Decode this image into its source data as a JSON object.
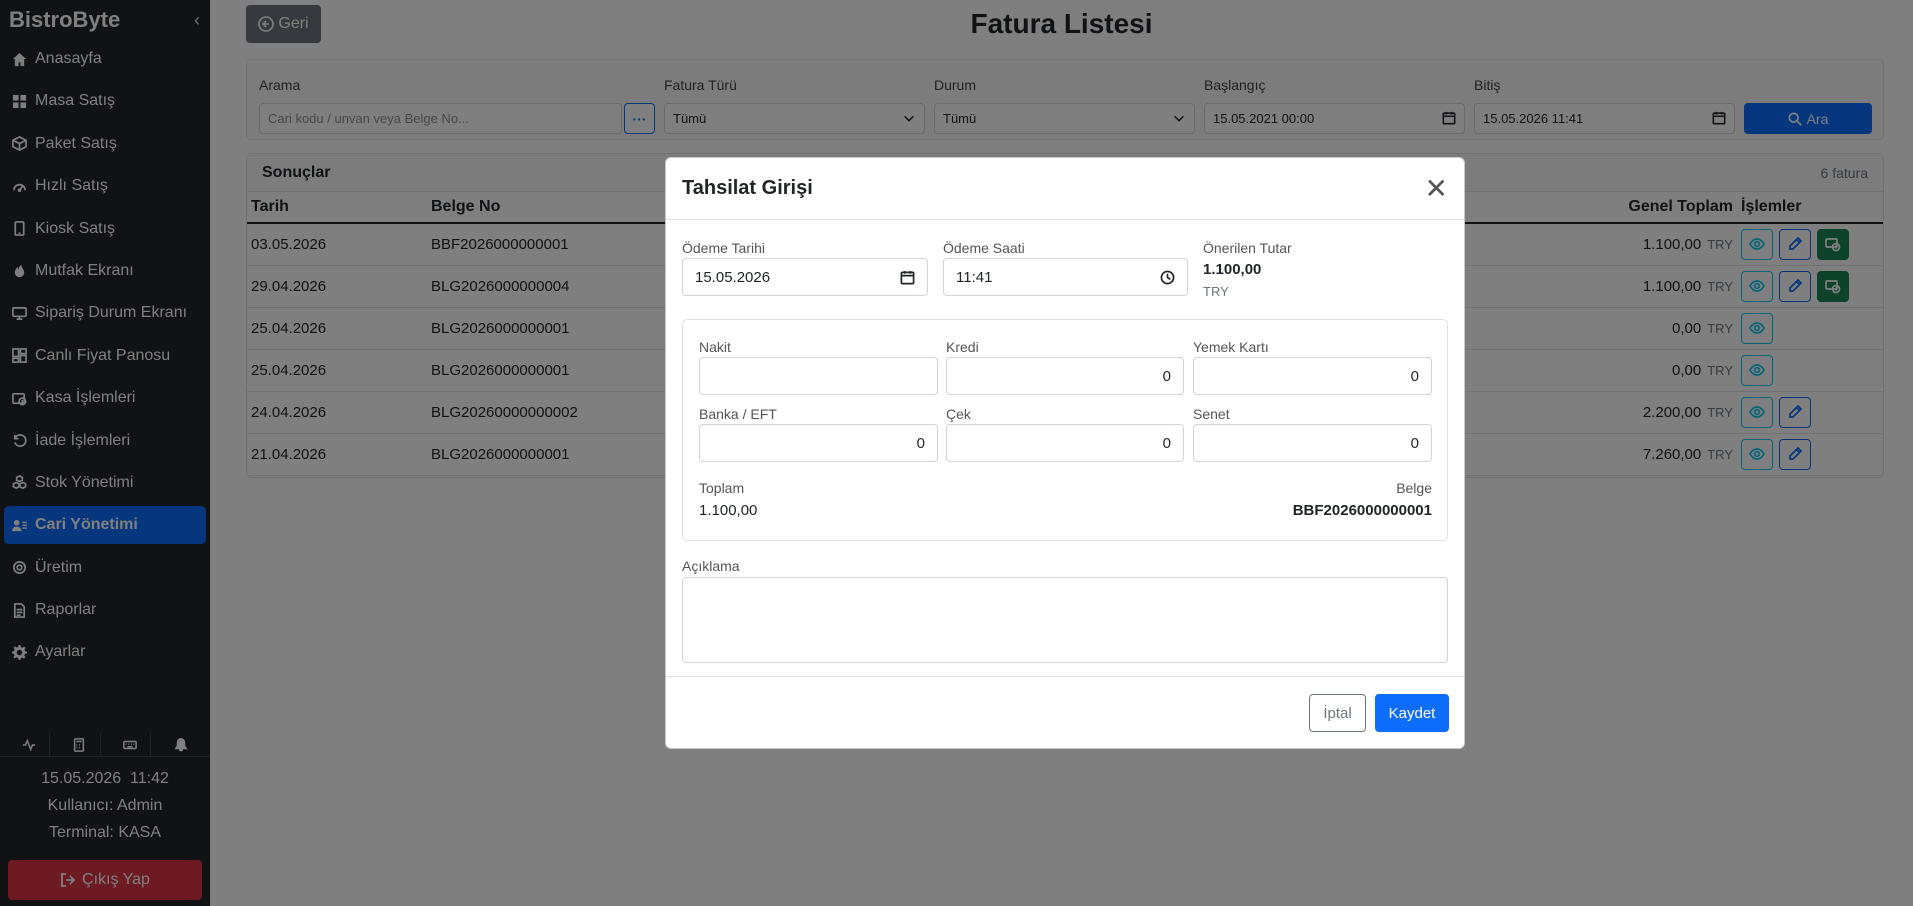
{
  "app": {
    "brand": "BistroByte"
  },
  "sidebar": {
    "items": [
      {
        "label": "Anasayfa",
        "icon": "home-icon"
      },
      {
        "label": "Masa Satış",
        "icon": "grid-icon"
      },
      {
        "label": "Paket Satış",
        "icon": "box-icon"
      },
      {
        "label": "Hızlı Satış",
        "icon": "speedometer-icon"
      },
      {
        "label": "Kiosk Satış",
        "icon": "tablet-icon"
      },
      {
        "label": "Mutfak Ekranı",
        "icon": "fire-icon"
      },
      {
        "label": "Sipariş Durum Ekranı",
        "icon": "monitor-icon"
      },
      {
        "label": "Canlı Fiyat Panosu",
        "icon": "dashboard-icon"
      },
      {
        "label": "Kasa İşlemleri",
        "icon": "cash-register-icon"
      },
      {
        "label": "İade İşlemleri",
        "icon": "undo-icon"
      },
      {
        "label": "Stok Yönetimi",
        "icon": "boxes-icon"
      },
      {
        "label": "Cari Yönetimi",
        "icon": "users-icon",
        "active": true
      },
      {
        "label": "Üretim",
        "icon": "gear-icon"
      },
      {
        "label": "Raporlar",
        "icon": "report-icon"
      },
      {
        "label": "Ayarlar",
        "icon": "settings-icon"
      }
    ],
    "footer": {
      "datetime": "15.05.2026  11:42",
      "user": "Kullanıcı: Admin",
      "terminal": "Terminal: KASA",
      "logout": "Çıkış Yap"
    }
  },
  "page": {
    "back": "Geri",
    "title": "Fatura Listesi"
  },
  "filters": {
    "search_label": "Arama",
    "search_placeholder": "Cari kodu / unvan veya Belge No...",
    "type_label": "Fatura Türü",
    "type_value": "Tümü",
    "status_label": "Durum",
    "status_value": "Tümü",
    "start_label": "Başlangıç",
    "start_value": "15.05.2021 00:00",
    "end_label": "Bitiş",
    "end_value": "15.05.2026 11:41",
    "search_button": "Ara"
  },
  "results": {
    "title": "Sonuçlar",
    "count": "6 fatura",
    "columns": {
      "date": "Tarih",
      "doc_no": "Belge No",
      "total": "Genel Toplam",
      "actions": "İşlemler"
    },
    "rows": [
      {
        "date": "03.05.2026",
        "doc_no": "BBF2026000000001",
        "total": "1.100,00",
        "currency": "TRY",
        "edit": true,
        "pay": true
      },
      {
        "date": "29.04.2026",
        "doc_no": "BLG2026000000004",
        "total": "1.100,00",
        "currency": "TRY",
        "edit": true,
        "pay": true
      },
      {
        "date": "25.04.2026",
        "doc_no": "BLG2026000000001",
        "total": "0,00",
        "currency": "TRY",
        "edit": false,
        "pay": false
      },
      {
        "date": "25.04.2026",
        "doc_no": "BLG2026000000001",
        "total": "0,00",
        "currency": "TRY",
        "edit": false,
        "pay": false
      },
      {
        "date": "24.04.2026",
        "doc_no": "BLG20260000000002",
        "total": "2.200,00",
        "currency": "TRY",
        "edit": true,
        "pay": false
      },
      {
        "date": "21.04.2026",
        "doc_no": "BLG2026000000001",
        "total": "7.260,00",
        "currency": "TRY",
        "edit": true,
        "pay": false
      }
    ]
  },
  "modal": {
    "title": "Tahsilat Girişi",
    "payment_date_label": "Ödeme Tarihi",
    "payment_date": "15.05.2026",
    "payment_time_label": "Ödeme Saati",
    "payment_time": "11:41",
    "suggested_label": "Önerilen Tutar",
    "suggested_amount": "1.100,00",
    "suggested_currency": "TRY",
    "cash_label": "Nakit",
    "cash_value": "",
    "credit_label": "Kredi",
    "credit_value": "0",
    "meal_card_label": "Yemek Kartı",
    "meal_card_value": "0",
    "bank_label": "Banka / EFT",
    "bank_value": "0",
    "check_label": "Çek",
    "check_value": "0",
    "note_label": "Senet",
    "note_value": "0",
    "total_label": "Toplam",
    "total_value": "1.100,00",
    "doc_label": "Belge",
    "doc_value": "BBF2026000000001",
    "description_label": "Açıklama",
    "description_value": "",
    "cancel": "İptal",
    "save": "Kaydet"
  },
  "colors": {
    "primary": "#0d6efd",
    "danger": "#dc3545",
    "success": "#198754",
    "sidebar": "#212529",
    "info": "#0dcaf0"
  }
}
